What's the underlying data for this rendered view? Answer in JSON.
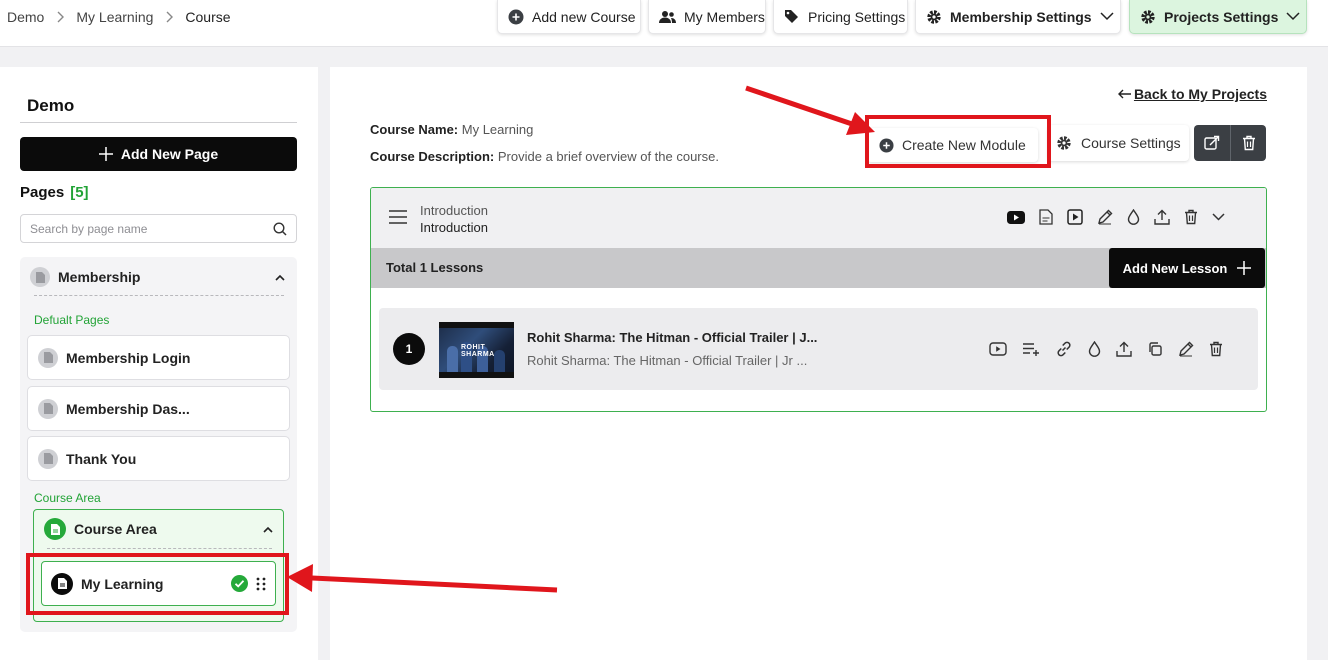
{
  "breadcrumb": [
    "Demo",
    "My Learning",
    "Course"
  ],
  "topnav": {
    "add_course": "Add new Course",
    "members": "My Members",
    "pricing": "Pricing Settings",
    "membership_settings": "Membership Settings",
    "projects_settings": "Projects Settings"
  },
  "sidebar": {
    "title": "Demo",
    "add_page": "Add New Page",
    "pages_label": "Pages",
    "pages_count": "[5]",
    "search_placeholder": "Search by page name",
    "group_title": "Membership",
    "default_label": "Defualt Pages",
    "default_pages": [
      "Membership Login",
      "Membership Das...",
      "Thank You"
    ],
    "course_area_label": "Course Area",
    "course_area_title": "Course Area",
    "active_page": "My Learning"
  },
  "main": {
    "back_link": "Back to My Projects",
    "course_name_label": "Course Name:",
    "course_name": "My Learning",
    "course_desc_label": "Course Description:",
    "course_desc": "Provide a brief overview of the course.",
    "create_module": "Create New Module",
    "course_settings": "Course Settings",
    "module": {
      "title": "Introduction",
      "subtitle": "Introduction",
      "lessons_total": "Total 1 Lessons",
      "add_lesson": "Add New Lesson"
    },
    "lesson": {
      "number": "1",
      "title": "Rohit Sharma: The Hitman - Official Trailer | J...",
      "subtitle": "Rohit Sharma: The Hitman - Official Trailer | Jr ...",
      "thumb_text": "ROHIT SHARMA"
    }
  },
  "colors": {
    "accent_green": "#22a336",
    "highlight_red": "#e0161c",
    "dark": "#0b0b0b"
  }
}
